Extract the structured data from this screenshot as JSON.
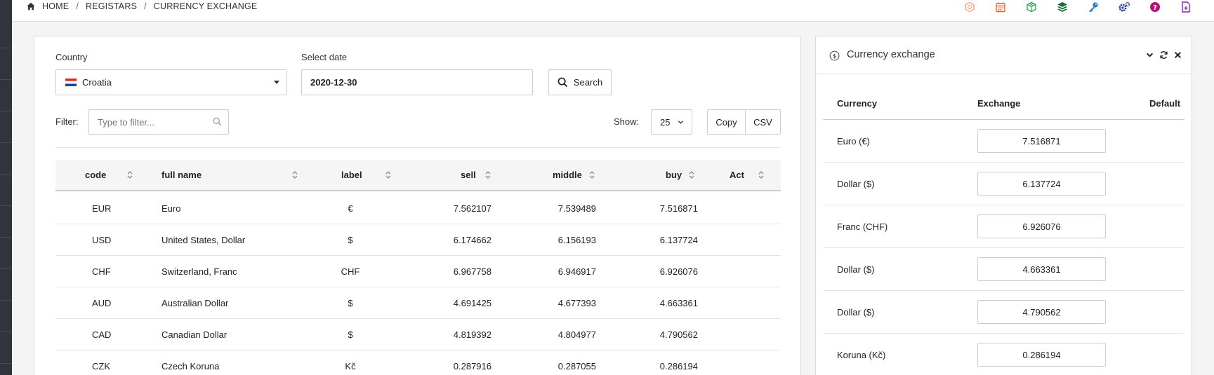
{
  "breadcrumb": {
    "home": "HOME",
    "registars": "REGISTARS",
    "current": "CURRENCY EXCHANGE"
  },
  "top_icons": [
    {
      "name": "hexagon-icon",
      "color": "#f39c77"
    },
    {
      "name": "calendar-icon",
      "color": "#e06b2c"
    },
    {
      "name": "cube-icon",
      "color": "#2e9b4a"
    },
    {
      "name": "layers-icon",
      "color": "#1a6b36"
    },
    {
      "name": "key-icon",
      "color": "#1b7fc4"
    },
    {
      "name": "gears-icon",
      "color": "#2b3a8a"
    },
    {
      "name": "help-icon",
      "color": "#b0137a"
    },
    {
      "name": "new-document-icon",
      "color": "#8e24aa"
    }
  ],
  "form": {
    "country_label": "Country",
    "country_value": "Croatia",
    "date_label": "Select date",
    "date_value": "2020-12-30",
    "search_label": "Search",
    "filter_label": "Filter:",
    "filter_placeholder": "Type to filter...",
    "show_label": "Show:",
    "show_value": "25",
    "copy_label": "Copy",
    "csv_label": "CSV"
  },
  "table": {
    "columns": [
      "code",
      "full name",
      "label",
      "sell",
      "middle",
      "buy",
      "Act"
    ],
    "rows": [
      {
        "code": "EUR",
        "full_name": "Euro",
        "label": "€",
        "sell": "7.562107",
        "middle": "7.539489",
        "buy": "7.516871"
      },
      {
        "code": "USD",
        "full_name": "United States, Dollar",
        "label": "$",
        "sell": "6.174662",
        "middle": "6.156193",
        "buy": "6.137724"
      },
      {
        "code": "CHF",
        "full_name": "Switzerland, Franc",
        "label": "CHF",
        "sell": "6.967758",
        "middle": "6.946917",
        "buy": "6.926076"
      },
      {
        "code": "AUD",
        "full_name": "Australian Dollar",
        "label": "$",
        "sell": "4.691425",
        "middle": "4.677393",
        "buy": "4.663361"
      },
      {
        "code": "CAD",
        "full_name": "Canadian Dollar",
        "label": "$",
        "sell": "4.819392",
        "middle": "4.804977",
        "buy": "4.790562"
      },
      {
        "code": "CZK",
        "full_name": "Czech Koruna",
        "label": "Kč",
        "sell": "0.287916",
        "middle": "0.287055",
        "buy": "0.286194"
      }
    ]
  },
  "side_panel": {
    "title": "Currency exchange",
    "columns": [
      "Currency",
      "Exchange",
      "Default"
    ],
    "rows": [
      {
        "currency": "Euro (€)",
        "exchange": "7.516871"
      },
      {
        "currency": "Dollar ($)",
        "exchange": "6.137724"
      },
      {
        "currency": "Franc (CHF)",
        "exchange": "6.926076"
      },
      {
        "currency": "Dollar ($)",
        "exchange": "4.663361"
      },
      {
        "currency": "Dollar ($)",
        "exchange": "4.790562"
      },
      {
        "currency": "Koruna (Kč)",
        "exchange": "0.286194"
      }
    ]
  }
}
